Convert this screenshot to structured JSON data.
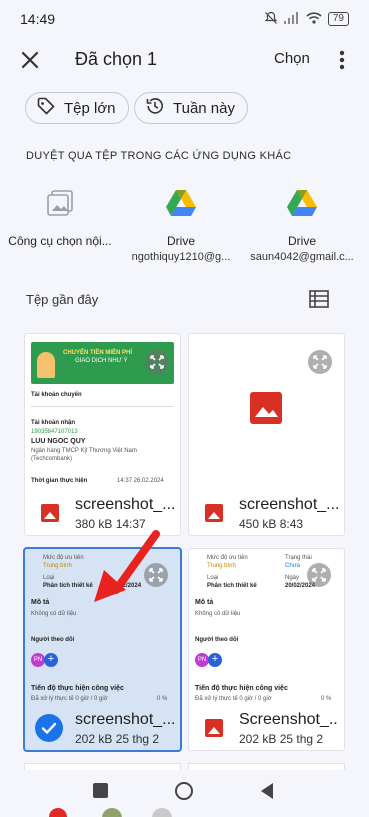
{
  "status": {
    "time": "14:49",
    "battery": "79"
  },
  "header": {
    "title": "Đã chọn 1",
    "select_label": "Chọn"
  },
  "filters": [
    {
      "label": "Tệp lớn",
      "icon": "tag-icon"
    },
    {
      "label": "Tuần này",
      "icon": "history-icon"
    }
  ],
  "browse": {
    "heading": "DUYỆT QUA TỆP TRONG CÁC ỨNG DỤNG KHÁC",
    "sources": [
      {
        "name": "Công cụ chọn nội...",
        "account": "",
        "icon": "photo-picker-icon"
      },
      {
        "name": "Drive",
        "account": "ngothiquy1210@g...",
        "icon": "google-drive-icon"
      },
      {
        "name": "Drive",
        "account": "saun4042@gmail.c...",
        "icon": "google-drive-icon"
      }
    ]
  },
  "recent": {
    "heading": "Tệp gần đây",
    "files": [
      {
        "name": "screenshot_...",
        "meta": "380 kB 14:37",
        "selected": false,
        "preview": {
          "banner_title": "CHUYỂN TIỀN MIỄN PHÍ",
          "banner_sub": "GIAO DỊCH NHƯ Ý",
          "from_label": "Tài khoản chuyển",
          "to_label": "Tài khoản nhận",
          "account_no": "19035847107013",
          "account_name": "LUU NGOC QUY",
          "bank_line1": "Ngân hàng TMCP Kỹ Thương Việt Nam",
          "bank_line2": "(Techcombank)",
          "time_label": "Thời gian thực hiện",
          "time_value": "14:37 26.02.2024"
        }
      },
      {
        "name": "screenshot_...",
        "meta": "450 kB 8:43",
        "selected": false
      },
      {
        "name": "screenshot_...",
        "meta": "202 kB 25 thg 2",
        "selected": true,
        "preview": {
          "priority_label": "Mức độ ưu tiên",
          "priority_value": "Trung bình",
          "type_label": "Loại",
          "type_value": "Phân tích thiết kế",
          "date": "20/02/2024",
          "desc_label": "Mô tả",
          "desc_value": "Không có dữ liệu",
          "followers_label": "Người theo dõi",
          "avatar": "PN",
          "progress_label": "Tiến độ thực hiện công việc",
          "progress_line": "Đã xử lý thực tế 0 giờ / 0 giờ",
          "progress_pct": "0 %"
        }
      },
      {
        "name": "Screenshot_...",
        "meta": "202 kB 25 thg 2",
        "selected": false,
        "preview": {
          "priority_label": "Mức độ ưu tiên",
          "priority_value": "Trung bình",
          "status_label": "Trạng thái",
          "status_value": "Chưa",
          "type_label": "Loại",
          "type_value": "Phân tích thiết kế",
          "day_label": "Ngày",
          "date": "20/02/2024",
          "desc_label": "Mô tả",
          "desc_value": "Không có dữ liệu",
          "followers_label": "Người theo dõi",
          "avatar": "PN",
          "progress_label": "Tiến độ thực hiện công việc",
          "progress_line": "Đã xử lý thực tế 0 giờ / 0 giờ",
          "progress_pct": "0 %"
        }
      }
    ]
  },
  "colors": {
    "accent": "#1a73e8",
    "selected_bg": "#d6e3f5",
    "image_red": "#d93025",
    "arrow": "#e8231f"
  }
}
